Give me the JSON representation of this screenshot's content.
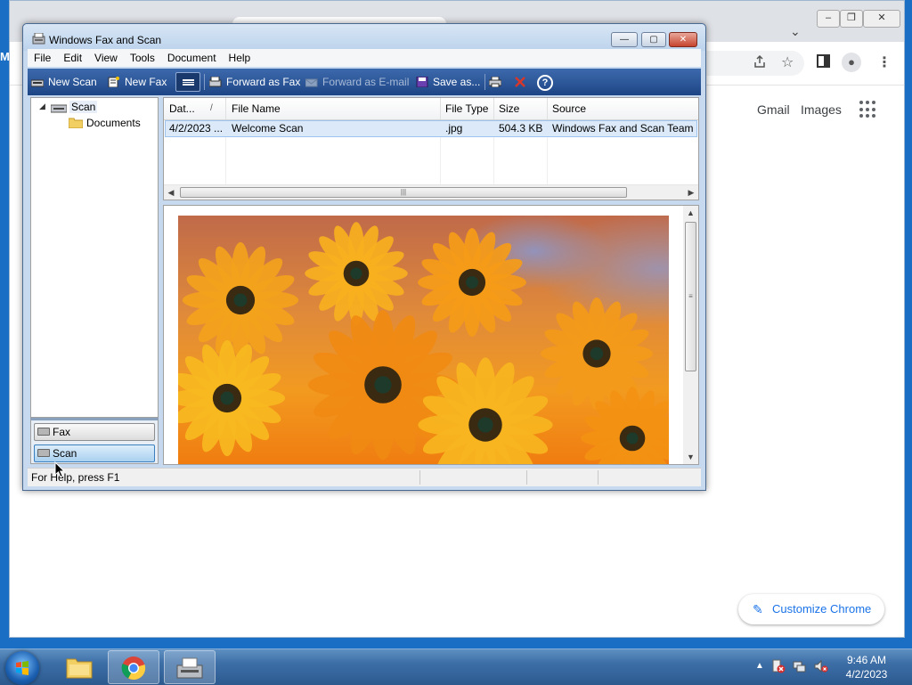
{
  "chrome": {
    "links": {
      "gmail": "Gmail",
      "images": "Images"
    },
    "customize_label": "Customize Chrome",
    "desktop_letter": "M",
    "icons": [
      "share-icon",
      "star-icon",
      "side-panel-icon",
      "profile-icon",
      "menu-dots-icon",
      "apps-grid-icon",
      "pencil-icon"
    ]
  },
  "window": {
    "title": "Windows Fax and Scan",
    "menu": [
      "File",
      "Edit",
      "View",
      "Tools",
      "Document",
      "Help"
    ],
    "toolbar": {
      "new_scan": "New Scan",
      "new_fax": "New Fax",
      "forward_fax": "Forward as Fax",
      "forward_email": "Forward as E-mail",
      "save_as": "Save as...",
      "help_glyph": "?"
    },
    "tree": {
      "root": "Scan",
      "child": "Documents"
    },
    "nav": {
      "fax": "Fax",
      "scan": "Scan"
    },
    "list": {
      "columns": [
        "Dat...",
        "File Name",
        "File Type",
        "Size",
        "Source"
      ],
      "sort_indicator": "/",
      "rows": [
        {
          "date": "4/2/2023 ...",
          "name": "Welcome Scan",
          "type": ".jpg",
          "size": "504.3 KB",
          "source": "Windows Fax and Scan Team"
        }
      ]
    },
    "status": "For Help, press F1",
    "accent": "#2a5597"
  },
  "taskbar": {
    "time": "9:46 AM",
    "date": "4/2/2023",
    "tray_arrow": "▲"
  }
}
